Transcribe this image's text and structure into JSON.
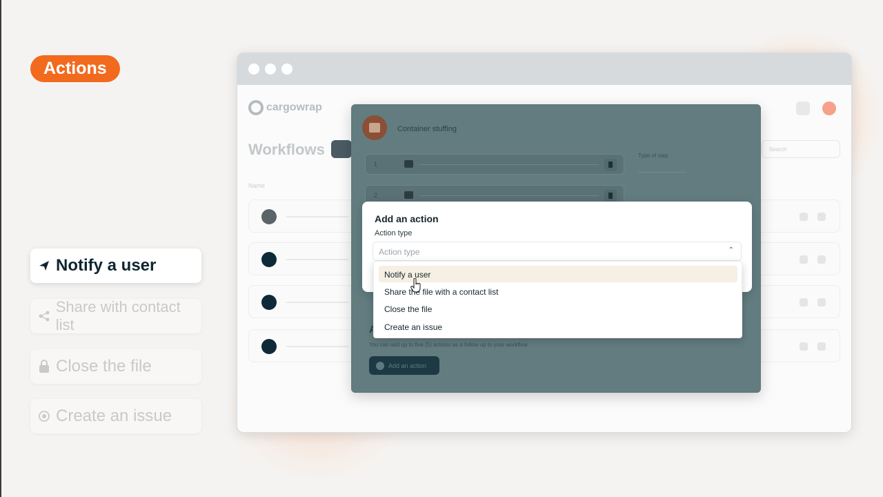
{
  "badge": {
    "label": "Actions",
    "color": "#f26a1e"
  },
  "side_list": [
    {
      "label": "Notify a user",
      "icon": "paper-plane-icon",
      "state": "active"
    },
    {
      "label": "Share with contact list",
      "icon": "share-icon",
      "state": "dim"
    },
    {
      "label": "Close the file",
      "icon": "lock-icon",
      "state": "dim"
    },
    {
      "label": "Create an issue",
      "icon": "target-icon",
      "state": "dim"
    }
  ],
  "app": {
    "logo": "cargowrap",
    "page_title": "Workflows",
    "column_name": "Name",
    "rows": [
      {
        "name": "Container stuffing"
      }
    ],
    "search_placeholder": "Search"
  },
  "workflow_modal": {
    "title": "Container stuffing",
    "steps": [
      "1",
      "2"
    ],
    "type_of_step_label": "Type of step",
    "actions_heading": "A",
    "actions_help": "You can add up to five (5) actions as a follow up to your workflow",
    "add_action_label": "Add an action"
  },
  "add_action_dialog": {
    "title": "Add an action",
    "field_label": "Action type",
    "select_placeholder": "Action type",
    "options": [
      {
        "label": "Notify a user",
        "highlighted": true
      },
      {
        "label": "Share the file with a contact list",
        "highlighted": false
      },
      {
        "label": "Close the file",
        "highlighted": false
      },
      {
        "label": "Create an issue",
        "highlighted": false
      }
    ]
  }
}
